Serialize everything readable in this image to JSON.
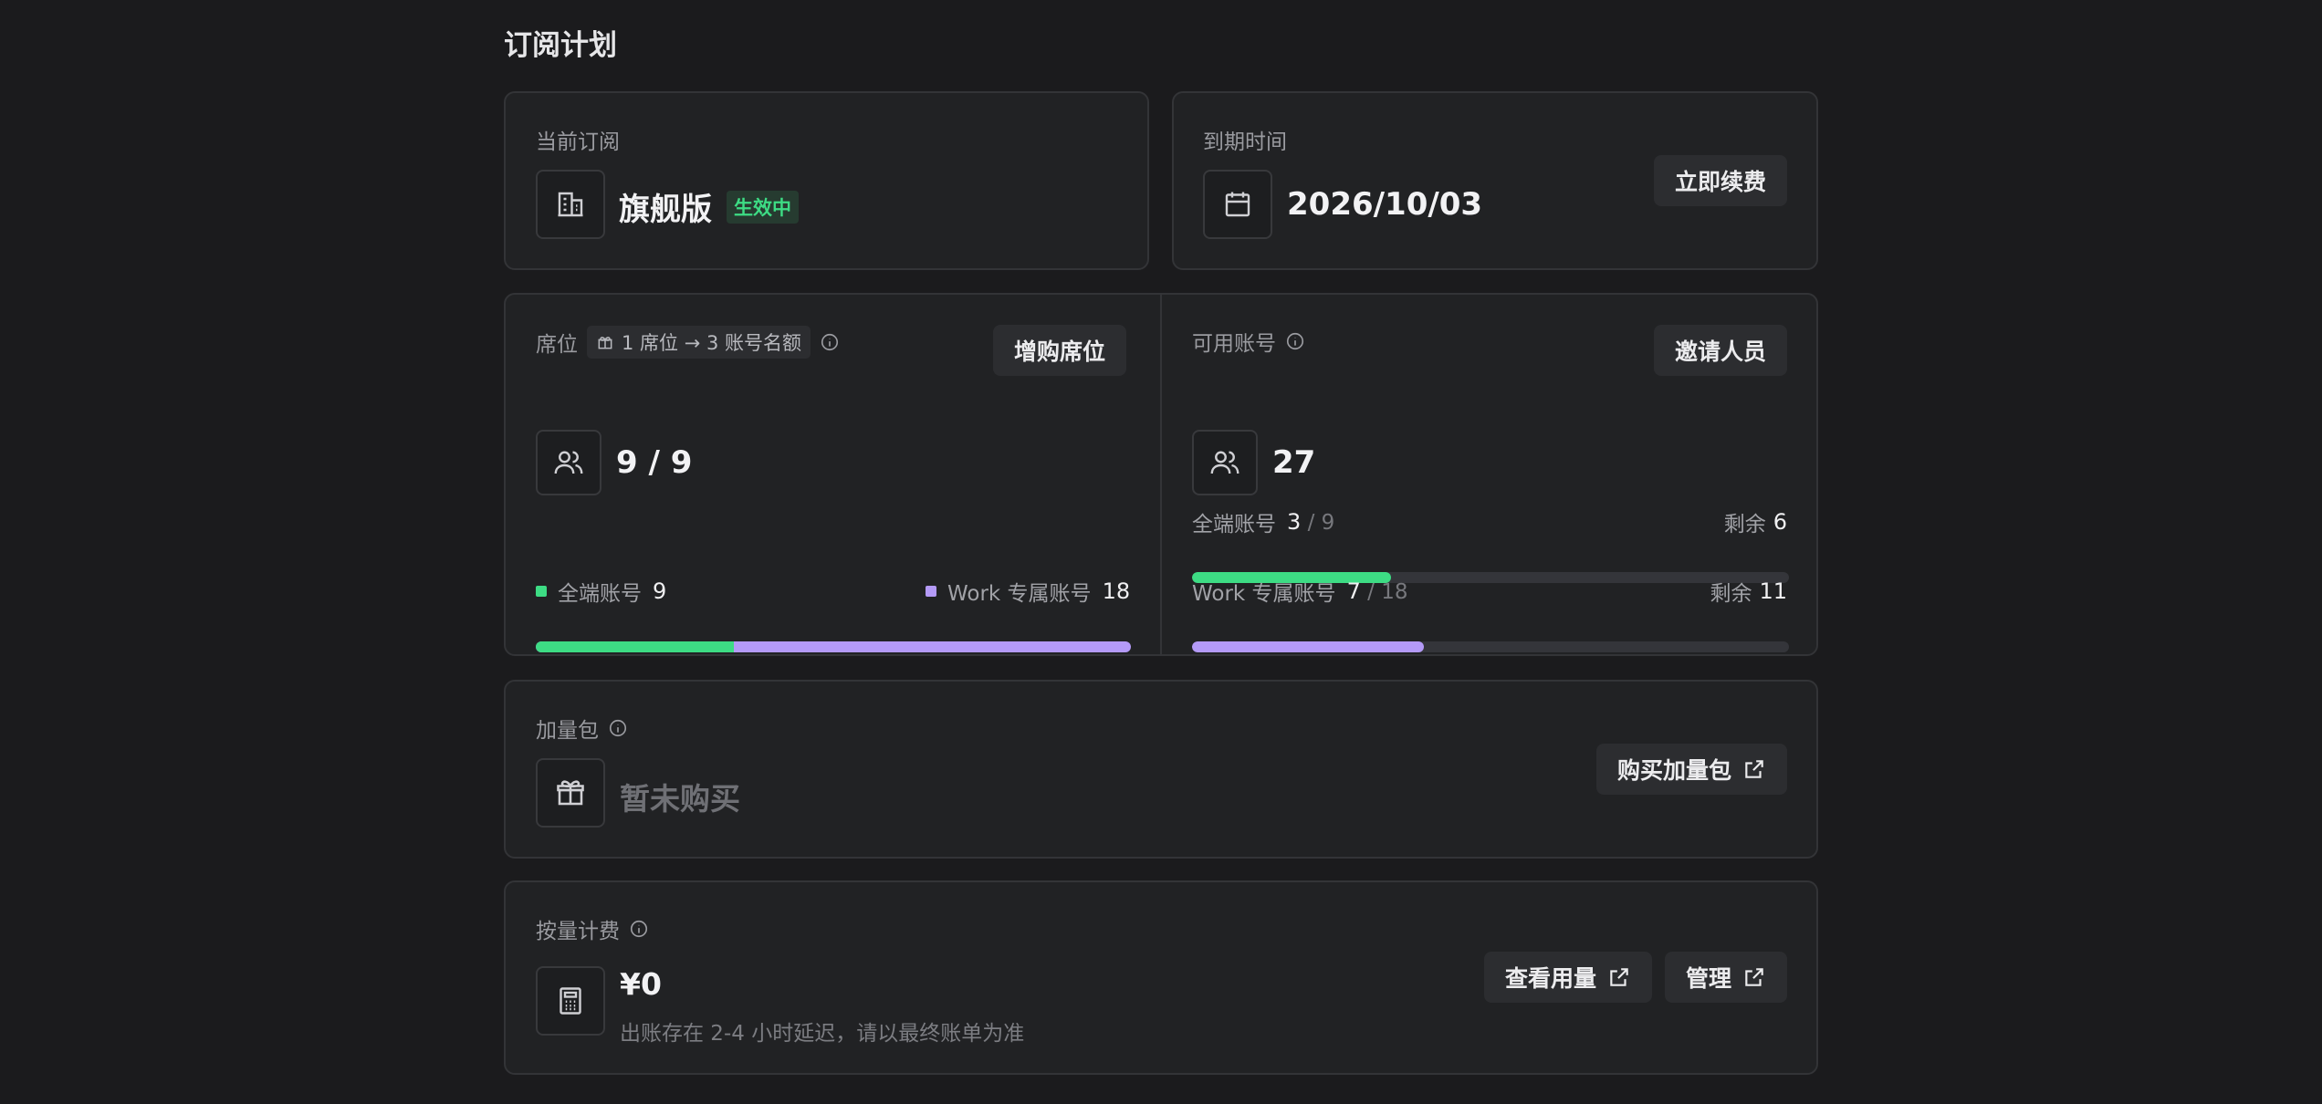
{
  "page_title": "订阅计划",
  "subscription": {
    "label": "当前订阅",
    "plan": "旗舰版",
    "status": "生效中",
    "icon": "building-icon"
  },
  "expiry": {
    "label": "到期时间",
    "date": "2026/10/03",
    "renew_button": "立即续费",
    "icon": "calendar-icon"
  },
  "seats": {
    "label": "席位",
    "chip": "1 席位 → 3 账号名额",
    "buy_button": "增购席位",
    "value": "9 / 9",
    "full_label": "全端账号",
    "full_value": "9",
    "work_label": "Work 专属账号",
    "work_value": "18",
    "full_fraction": 0.333,
    "icon": "users-icon"
  },
  "accounts": {
    "label": "可用账号",
    "invite_button": "邀请人员",
    "value": "27",
    "rows": [
      {
        "label": "全端账号",
        "used": "3",
        "total": "/ 9",
        "remain_label": "剩余",
        "remain": "6",
        "fraction": 0.333,
        "color": "#3ddc84"
      },
      {
        "label": "Work 专属账号",
        "used": "7",
        "total": "/ 18",
        "remain_label": "剩余",
        "remain": "11",
        "fraction": 0.389,
        "color": "#b49af7"
      }
    ]
  },
  "addon": {
    "label": "加量包",
    "value": "暂未购买",
    "buy_button": "购买加量包",
    "icon": "gift-icon"
  },
  "metered": {
    "label": "按量计费",
    "value": "¥0",
    "note": "出账存在 2-4 小时延迟，请以最终账单为准",
    "view_button": "查看用量",
    "manage_button": "管理",
    "icon": "calculator-icon"
  },
  "colors": {
    "green": "#3ddc84",
    "purple": "#b49af7"
  }
}
